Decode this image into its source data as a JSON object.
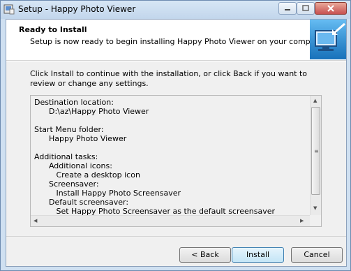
{
  "window": {
    "title": "Setup - Happy Photo Viewer"
  },
  "header": {
    "title": "Ready to Install",
    "subtitle": "Setup is now ready to begin installing Happy Photo Viewer on your computer."
  },
  "intro": "Click Install to continue with the installation, or click Back if you want to review or change any settings.",
  "memo": {
    "lines": [
      "Destination location:",
      "      D:\\az\\Happy Photo Viewer",
      "",
      "Start Menu folder:",
      "      Happy Photo Viewer",
      "",
      "Additional tasks:",
      "      Additional icons:",
      "         Create a desktop icon",
      "      Screensaver:",
      "         Install Happy Photo Screensaver",
      "      Default screensaver:",
      "         Set Happy Photo Screensaver as the default screensaver"
    ]
  },
  "buttons": {
    "back": "< Back",
    "install": "Install",
    "cancel": "Cancel"
  },
  "colors": {
    "titlebar": "#c2d6ec",
    "accent": "#3c7fb1",
    "close": "#c75050"
  }
}
